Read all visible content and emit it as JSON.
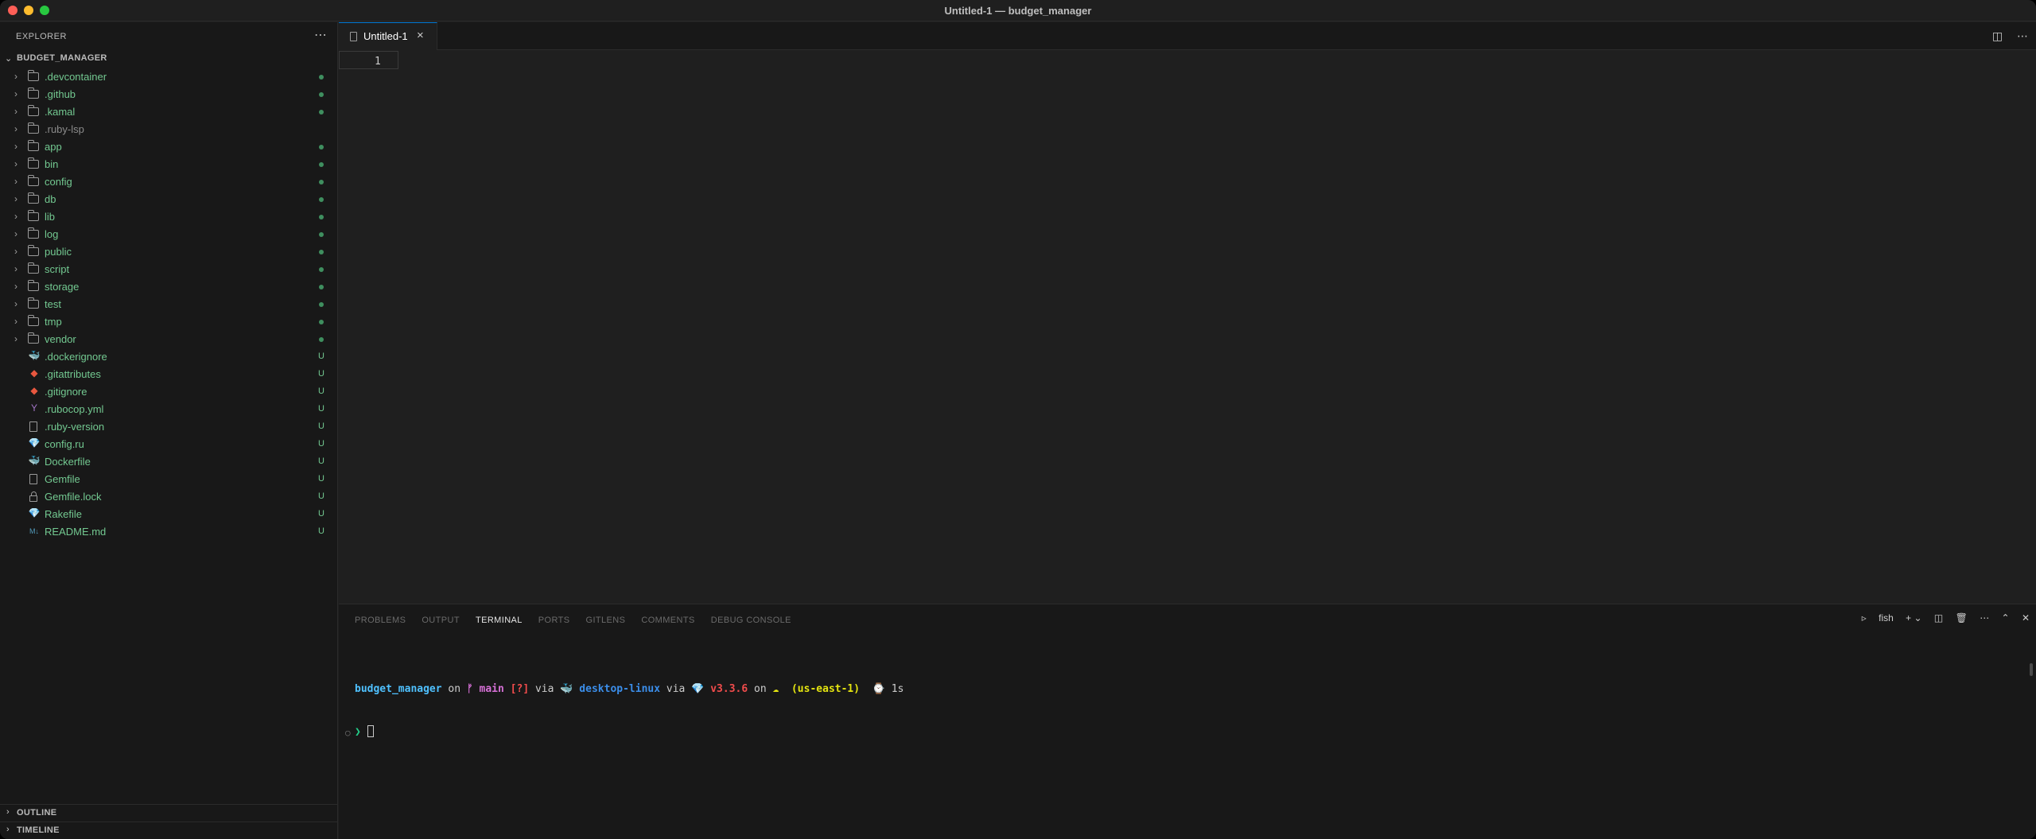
{
  "window": {
    "title": "Untitled-1 — budget_manager"
  },
  "sidebar": {
    "header": "EXPLORER",
    "more_icon": "ellipsis-icon",
    "root_label": "BUDGET_MANAGER",
    "folders": [
      {
        "name": ".devcontainer",
        "status": "dot"
      },
      {
        "name": ".github",
        "status": "dot"
      },
      {
        "name": ".kamal",
        "status": "dot"
      },
      {
        "name": ".ruby-lsp",
        "status": ""
      },
      {
        "name": "app",
        "status": "dot"
      },
      {
        "name": "bin",
        "status": "dot"
      },
      {
        "name": "config",
        "status": "dot"
      },
      {
        "name": "db",
        "status": "dot"
      },
      {
        "name": "lib",
        "status": "dot"
      },
      {
        "name": "log",
        "status": "dot"
      },
      {
        "name": "public",
        "status": "dot"
      },
      {
        "name": "script",
        "status": "dot"
      },
      {
        "name": "storage",
        "status": "dot"
      },
      {
        "name": "test",
        "status": "dot"
      },
      {
        "name": "tmp",
        "status": "dot"
      },
      {
        "name": "vendor",
        "status": "dot"
      }
    ],
    "files": [
      {
        "name": ".dockerignore",
        "status": "U",
        "icon": "docker-icon"
      },
      {
        "name": ".gitattributes",
        "status": "U",
        "icon": "git-icon"
      },
      {
        "name": ".gitignore",
        "status": "U",
        "icon": "git-icon"
      },
      {
        "name": ".rubocop.yml",
        "status": "U",
        "icon": "yaml-icon"
      },
      {
        "name": ".ruby-version",
        "status": "U",
        "icon": "file-icon"
      },
      {
        "name": "config.ru",
        "status": "U",
        "icon": "ruby-icon"
      },
      {
        "name": "Dockerfile",
        "status": "U",
        "icon": "docker-icon"
      },
      {
        "name": "Gemfile",
        "status": "U",
        "icon": "file-icon"
      },
      {
        "name": "Gemfile.lock",
        "status": "U",
        "icon": "lock-icon"
      },
      {
        "name": "Rakefile",
        "status": "U",
        "icon": "ruby-icon"
      },
      {
        "name": "README.md",
        "status": "U",
        "icon": "markdown-icon"
      }
    ],
    "outline_label": "OUTLINE",
    "timeline_label": "TIMELINE"
  },
  "editor": {
    "tab_label": "Untitled-1",
    "line_number": "1"
  },
  "panel": {
    "tabs": [
      "PROBLEMS",
      "OUTPUT",
      "TERMINAL",
      "PORTS",
      "GITLENS",
      "COMMENTS",
      "DEBUG CONSOLE"
    ],
    "active_tab": "TERMINAL",
    "shell_label": "fish",
    "terminal": {
      "dir": "budget_manager",
      "on1": " on ",
      "branch_icon": "ᚠ",
      "branch": " main ",
      "status": "[?]",
      "via1": " via ",
      "docker_icon": "🐳",
      "context": " desktop-linux",
      "via2": " via ",
      "ruby_icon": "💎",
      "ruby_version": " v3.3.6",
      "on2": " on ",
      "cloud_icon": "☁",
      "region": "  (us-east-1)",
      "timer_icon": "  ⌚",
      "duration": " 1s",
      "prompt": "❯ "
    }
  },
  "colors": {
    "accent": "#0078d4",
    "git_untracked": "#73c991"
  }
}
